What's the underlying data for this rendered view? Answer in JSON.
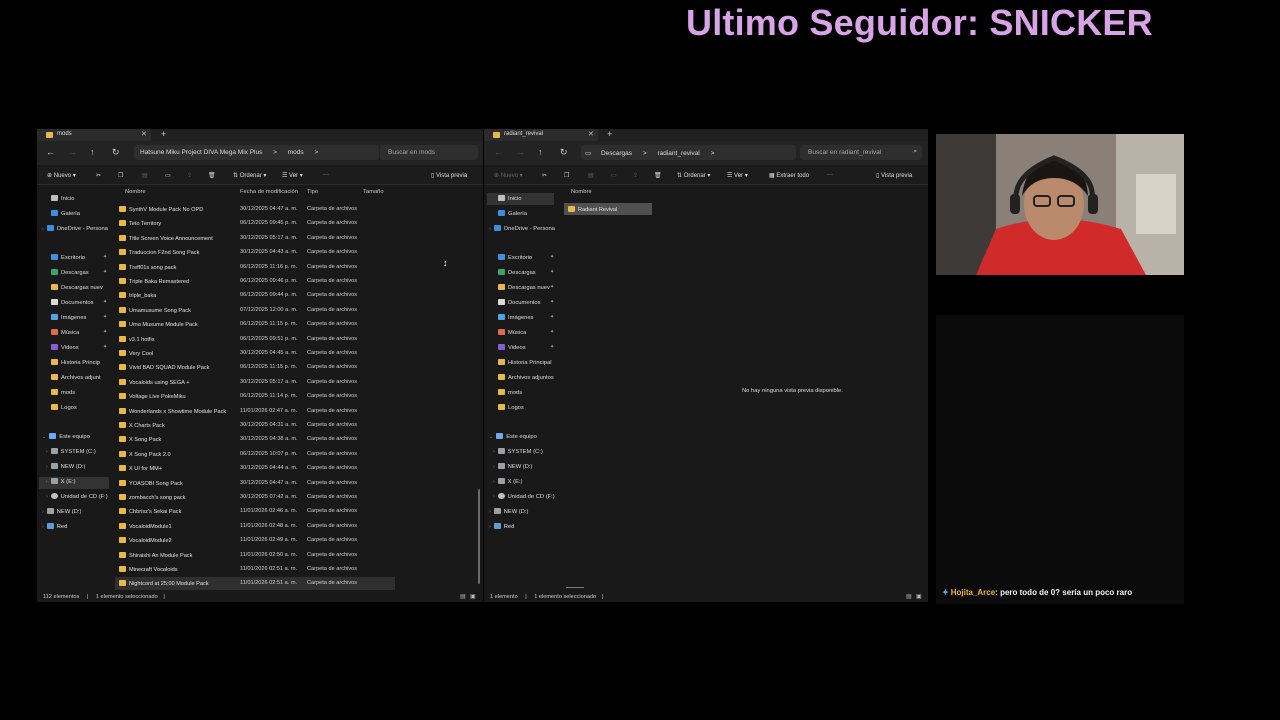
{
  "overlay": {
    "title": "Ultimo Seguidor: SNICKER"
  },
  "left_window": {
    "tab_title": "mods",
    "breadcrumb": [
      "Hatsune Miku Project DIVA Mega Mix Plus",
      ">",
      "mods",
      ">"
    ],
    "search_placeholder": "Buscar en mods",
    "commands": {
      "new": "Nuevo",
      "sort": "Ordenar",
      "view": "Ver",
      "more": "···",
      "preview": "Vista previa"
    },
    "columns": {
      "name": "Nombre",
      "date": "Fecha de modificación",
      "type": "Tipo",
      "size": "Tamaño"
    },
    "nav": [
      {
        "label": "Inicio",
        "icon": "home-icon"
      },
      {
        "label": "Galería",
        "icon": "gallery-icon"
      },
      {
        "label": "OneDrive - Persona",
        "icon": "onedrive-icon"
      },
      {
        "label": "Escritorio",
        "icon": "desktop-icon"
      },
      {
        "label": "Descargas",
        "icon": "downloads-icon"
      },
      {
        "label": "Descargas nuev",
        "icon": "folder-icon"
      },
      {
        "label": "Documentos",
        "icon": "documents-icon"
      },
      {
        "label": "Imágenes",
        "icon": "pictures-icon"
      },
      {
        "label": "Música",
        "icon": "music-icon"
      },
      {
        "label": "Videos",
        "icon": "videos-icon"
      },
      {
        "label": "Historia Princip",
        "icon": "folder-icon"
      },
      {
        "label": "Archivos adjunt",
        "icon": "folder-icon"
      },
      {
        "label": "mods",
        "icon": "folder-icon"
      },
      {
        "label": "Logos",
        "icon": "folder-icon"
      },
      {
        "label": "Este equipo",
        "icon": "this-pc-icon"
      },
      {
        "label": "SYSTEM (C:)",
        "icon": "drive-icon"
      },
      {
        "label": "NEW (D:)",
        "icon": "drive-icon"
      },
      {
        "label": "X (E:)",
        "icon": "drive-icon"
      },
      {
        "label": "Unidad de CD (F:)",
        "icon": "cd-drive-icon"
      },
      {
        "label": "NEW (D:)",
        "icon": "drive-icon"
      },
      {
        "label": "Red",
        "icon": "network-icon"
      }
    ],
    "files": [
      {
        "name": "SynthV Module Pack No OPD",
        "date": "30/12/2025 04:47 a. m.",
        "type": "Carpeta de archivos"
      },
      {
        "name": "Teto Territory",
        "date": "06/12/2025 09:45 p. m.",
        "type": "Carpeta de archivos"
      },
      {
        "name": "Title Screen Voice Announcement",
        "date": "30/12/2025 05:17 a. m.",
        "type": "Carpeta de archivos"
      },
      {
        "name": "Traduccion F2nd Song Pack",
        "date": "30/12/2025 04:43 a. m.",
        "type": "Carpeta de archivos"
      },
      {
        "name": "Treff01s song pack",
        "date": "06/12/2025 11:16 p. m.",
        "type": "Carpeta de archivos"
      },
      {
        "name": "Triple Baka Remastered",
        "date": "06/12/2025 09:46 p. m.",
        "type": "Carpeta de archivos"
      },
      {
        "name": "triple_baka",
        "date": "06/12/2025 09:44 p. m.",
        "type": "Carpeta de archivos"
      },
      {
        "name": "Umamusume Song Pack",
        "date": "07/12/2025 12:00 a. m.",
        "type": "Carpeta de archivos"
      },
      {
        "name": "Uma Musume Module Pack",
        "date": "06/12/2025 11:15 p. m.",
        "type": "Carpeta de archivos"
      },
      {
        "name": "v3.1 hotfix",
        "date": "06/12/2025 09:51 p. m.",
        "type": "Carpeta de archivos"
      },
      {
        "name": "Very Cool",
        "date": "30/12/2025 04:45 a. m.",
        "type": "Carpeta de archivos"
      },
      {
        "name": "Vivid BAD SQUAD Module Pack",
        "date": "06/12/2025 11:15 p. m.",
        "type": "Carpeta de archivos"
      },
      {
        "name": "Vocaloids using SEGA +",
        "date": "30/12/2025 05:17 a. m.",
        "type": "Carpeta de archivos"
      },
      {
        "name": "Voltage Live PokeMiku",
        "date": "06/12/2025 11:14 p. m.",
        "type": "Carpeta de archivos"
      },
      {
        "name": "Wonderlands x Showtime Module Pack",
        "date": "11/01/2026 02:47 a. m.",
        "type": "Carpeta de archivos"
      },
      {
        "name": "X Charts Pack",
        "date": "30/12/2025 04:31 a. m.",
        "type": "Carpeta de archivos"
      },
      {
        "name": "X Song Pack",
        "date": "30/12/2025 04:38 a. m.",
        "type": "Carpeta de archivos"
      },
      {
        "name": "X Song Pack 2.0",
        "date": "06/12/2025 10:07 p. m.",
        "type": "Carpeta de archivos"
      },
      {
        "name": "X UI for MM+",
        "date": "30/12/2025 04:44 a. m.",
        "type": "Carpeta de archivos"
      },
      {
        "name": "YOASOBI Song Pack",
        "date": "30/12/2025 04:47 a. m.",
        "type": "Carpeta de archivos"
      },
      {
        "name": "zombacch's song pack",
        "date": "30/12/2025 07:42 a. m.",
        "type": "Carpeta de archivos"
      },
      {
        "name": "Chbrisz's Sekai Pack",
        "date": "11/01/2026 02:46 a. m.",
        "type": "Carpeta de archivos"
      },
      {
        "name": "VocaloidModule1",
        "date": "11/01/2026 02:48 a. m.",
        "type": "Carpeta de archivos"
      },
      {
        "name": "VocaloidModule2",
        "date": "11/01/2026 02:49 a. m.",
        "type": "Carpeta de archivos"
      },
      {
        "name": "Shiraishi An Module Pack",
        "date": "11/01/2026 02:50 a. m.",
        "type": "Carpeta de archivos"
      },
      {
        "name": "Minecraft Vocaloids",
        "date": "11/01/2026 02:51 a. m.",
        "type": "Carpeta de archivos"
      },
      {
        "name": "Nightcord at 25:00 Module Pack",
        "date": "11/01/2026 02:51 a. m.",
        "type": "Carpeta de archivos",
        "selected": true
      }
    ],
    "status": {
      "count": "112 elementos",
      "sep": "|",
      "selected": "1 elemento seleccionado",
      "sep2": "|"
    }
  },
  "right_window": {
    "tab_title": "radiant_revival",
    "breadcrumb": [
      "Descargas",
      ">",
      "radiant_revival",
      ">"
    ],
    "search_placeholder": "Buscar en radiant_revival",
    "commands": {
      "new": "Nuevo",
      "sort": "Ordenar",
      "view": "Ver",
      "extract": "Extraer todo",
      "more": "···",
      "preview": "Vista previa"
    },
    "columns": {
      "name": "Nombre"
    },
    "nav": [
      {
        "label": "Inicio"
      },
      {
        "label": "Galería"
      },
      {
        "label": "OneDrive - Persona"
      },
      {
        "label": "Escritorio"
      },
      {
        "label": "Descargas"
      },
      {
        "label": "Descargas nuev"
      },
      {
        "label": "Documentos"
      },
      {
        "label": "Imágenes"
      },
      {
        "label": "Música"
      },
      {
        "label": "Videos"
      },
      {
        "label": "Historia Principal"
      },
      {
        "label": "Archivos adjuntos"
      },
      {
        "label": "mods"
      },
      {
        "label": "Logos"
      },
      {
        "label": "Este equipo"
      },
      {
        "label": "SYSTEM (C:)"
      },
      {
        "label": "NEW (D:)"
      },
      {
        "label": "X (E:)"
      },
      {
        "label": "Unidad de CD (F:)"
      },
      {
        "label": "NEW (D:)"
      },
      {
        "label": "Red"
      }
    ],
    "files": [
      {
        "name": "Radiant Revival",
        "selected": true
      }
    ],
    "preview_message": "No hay ninguna vista previa disponible.",
    "status": {
      "count": "1 elemento",
      "sep": "|",
      "selected": "1 elemento seleccionado",
      "sep2": "|"
    }
  },
  "chat": {
    "user": "Hojita_Arce",
    "colon": ":",
    "message": " pero todo de 0? sería un poco raro"
  },
  "icons": {
    "back": "←",
    "forward": "→",
    "up": "↑",
    "refresh": "↻",
    "close": "✕",
    "add": "+",
    "cut": "✂",
    "chevron": "›",
    "pin": "📌",
    "search": "⌕",
    "star": "✦"
  }
}
